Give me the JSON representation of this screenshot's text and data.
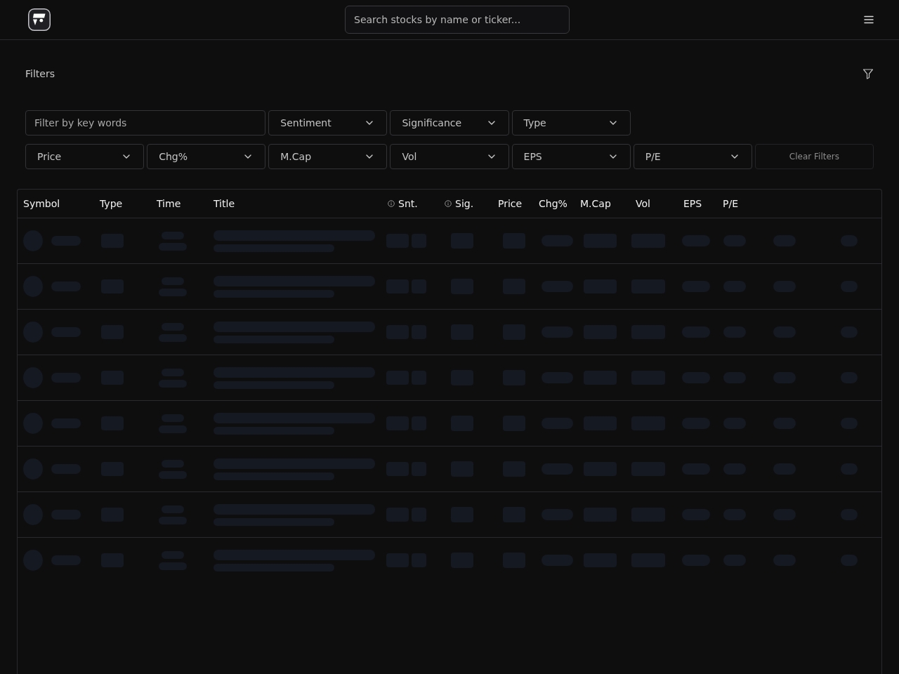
{
  "header": {
    "search": {
      "placeholder": "Search stocks by name or ticker..."
    }
  },
  "filters": {
    "title": "Filters",
    "keyword": {
      "placeholder": "Filter by key words"
    },
    "dropdowns_top": [
      {
        "label": "Sentiment"
      },
      {
        "label": "Significance"
      },
      {
        "label": "Type"
      }
    ],
    "dropdowns_bottom": [
      {
        "label": "Price"
      },
      {
        "label": "Chg%"
      },
      {
        "label": "M.Cap"
      },
      {
        "label": "Vol"
      },
      {
        "label": "EPS"
      },
      {
        "label": "P/E"
      }
    ],
    "clear_button": {
      "label": "Clear Filters"
    }
  },
  "table": {
    "columns": [
      {
        "label": "Symbol",
        "kind": "plain"
      },
      {
        "label": "Type",
        "kind": "plain"
      },
      {
        "label": "Time",
        "kind": "plain"
      },
      {
        "label": "Title",
        "kind": "plain"
      },
      {
        "label": "Snt.",
        "kind": "info"
      },
      {
        "label": "Sig.",
        "kind": "info"
      },
      {
        "label": "Price",
        "kind": "plain"
      },
      {
        "label": "Chg%",
        "kind": "plain"
      },
      {
        "label": "M.Cap",
        "kind": "plain"
      },
      {
        "label": "Vol",
        "kind": "plain"
      },
      {
        "label": "EPS",
        "kind": "plain"
      },
      {
        "label": "P/E",
        "kind": "plain"
      }
    ],
    "rows": [
      {
        "kind": "skeleton"
      },
      {
        "kind": "skeleton"
      },
      {
        "kind": "skeleton"
      },
      {
        "kind": "skeleton"
      },
      {
        "kind": "skeleton"
      },
      {
        "kind": "skeleton"
      },
      {
        "kind": "skeleton"
      },
      {
        "kind": "skeleton"
      }
    ]
  }
}
